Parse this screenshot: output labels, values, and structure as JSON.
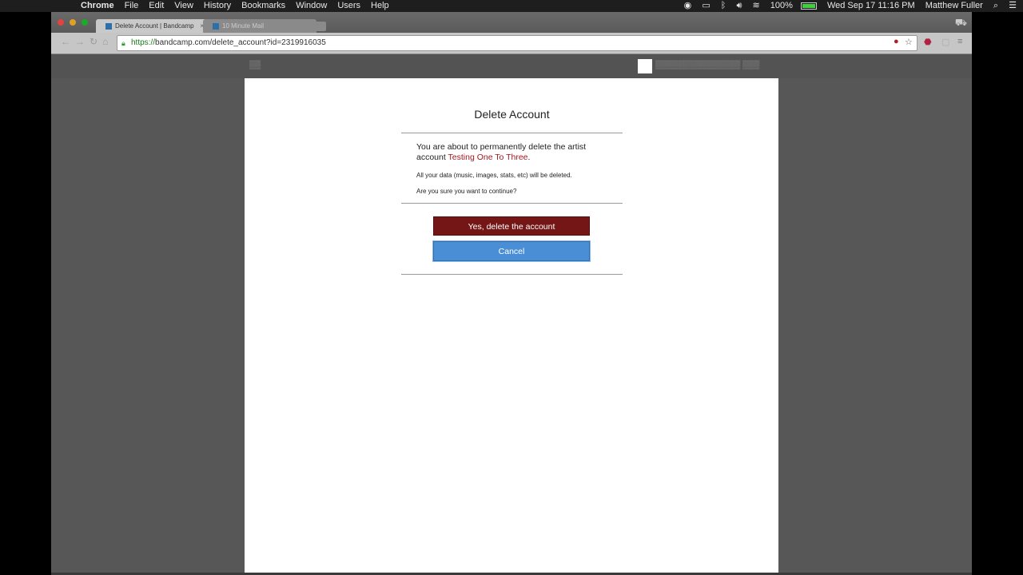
{
  "menubar": {
    "app": "Chrome",
    "items": [
      "File",
      "Edit",
      "View",
      "History",
      "Bookmarks",
      "Window",
      "Users",
      "Help"
    ],
    "battery": "100%",
    "datetime": "Wed Sep 17  11:16 PM",
    "user": "Matthew Fuller"
  },
  "browser": {
    "tabs": [
      {
        "label": "Delete Account | Bandcamp",
        "active": true
      },
      {
        "label": "10 Minute Mail",
        "active": false
      }
    ],
    "url_scheme": "https://",
    "url_rest": "bandcamp.com/delete_account?id=2319916035"
  },
  "dialog": {
    "title": "Delete Account",
    "message_prefix": "You are about to permanently delete the artist account ",
    "artist_name": "Testing One To Three",
    "message_suffix": ".",
    "data_note": "All your data (music, images, stats, etc) will be deleted.",
    "confirm_question": "Are you sure you want to continue?",
    "delete_button": "Yes, delete the account",
    "cancel_button": "Cancel"
  },
  "colors": {
    "delete_button": "#741616",
    "cancel_button": "#4a8fd6",
    "artist_link": "#a01820"
  }
}
